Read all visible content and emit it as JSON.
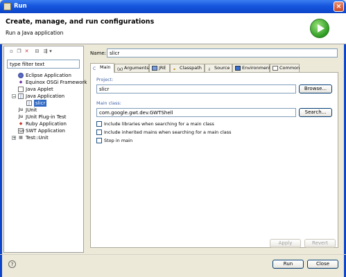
{
  "window": {
    "title": "Run",
    "close": "×"
  },
  "header": {
    "title": "Create, manage, and run configurations",
    "subtitle": "Run a Java application"
  },
  "left": {
    "toolbar_icons": [
      "new-config-icon",
      "duplicate-icon",
      "delete-icon",
      "collapse-icon",
      "filter-icon",
      "dropdown-icon"
    ],
    "filter_placeholder": "type filter text",
    "tree": [
      {
        "label": "Eclipse Application",
        "icon": "eclipse-icon"
      },
      {
        "label": "Equinox OSGi Framework",
        "icon": "osgi-icon"
      },
      {
        "label": "Java Applet",
        "icon": "applet-icon"
      },
      {
        "label": "Java Application",
        "icon": "java-app-icon",
        "expander": "−"
      },
      {
        "label": "slicr",
        "icon": "java-app-icon",
        "selected": true
      },
      {
        "label": "JUnit",
        "icon": "junit-icon"
      },
      {
        "label": "JUnit Plug-in Test",
        "icon": "junit-plugin-icon"
      },
      {
        "label": "Ruby Application",
        "icon": "ruby-icon"
      },
      {
        "label": "SWT Application",
        "icon": "swt-icon"
      },
      {
        "label": "Test::Unit",
        "icon": "testunit-icon",
        "expander": "+"
      }
    ]
  },
  "right": {
    "name_label": "Name:",
    "name_value": "slicr",
    "tabs": [
      {
        "label": "Main",
        "active": true
      },
      {
        "label": "Arguments"
      },
      {
        "label": "JRE"
      },
      {
        "label": "Classpath"
      },
      {
        "label": "Source"
      },
      {
        "label": "Environment"
      },
      {
        "label": "Common"
      }
    ],
    "project_label": "Project:",
    "project_value": "slicr",
    "browse_label": "Browse...",
    "main_class_label": "Main class:",
    "main_class_value": "com.google.gwt.dev.GWTShell",
    "search_label": "Search...",
    "checkboxes": [
      {
        "label": "Include libraries when searching for a main class",
        "checked": false
      },
      {
        "label": "Include inherited mains when searching for a main class",
        "checked": false
      },
      {
        "label": "Stop in main",
        "checked": false
      }
    ],
    "apply_label": "Apply",
    "revert_label": "Revert"
  },
  "footer": {
    "help": "?",
    "run_label": "Run",
    "close_label": "Close"
  }
}
